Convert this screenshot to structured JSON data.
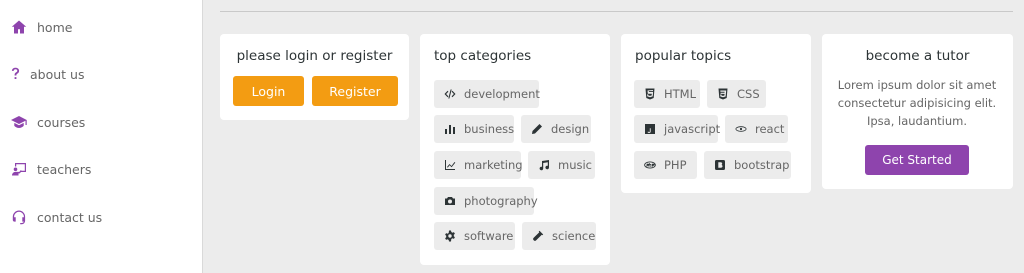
{
  "sidebar": {
    "items": [
      {
        "label": "home",
        "icon": "home-icon"
      },
      {
        "label": "about us",
        "icon": "question-icon"
      },
      {
        "label": "courses",
        "icon": "graduation-cap-icon"
      },
      {
        "label": "teachers",
        "icon": "chalkboard-teacher-icon"
      },
      {
        "label": "contact us",
        "icon": "headset-icon"
      }
    ]
  },
  "login_card": {
    "title": "please login or register",
    "login_label": "Login",
    "register_label": "Register"
  },
  "categories_card": {
    "title": "top categories",
    "tags": [
      {
        "label": "development",
        "icon": "code-icon"
      },
      {
        "label": "business",
        "icon": "bar-chart-icon"
      },
      {
        "label": "design",
        "icon": "pen-icon"
      },
      {
        "label": "marketing",
        "icon": "line-chart-icon"
      },
      {
        "label": "music",
        "icon": "music-icon"
      },
      {
        "label": "photography",
        "icon": "camera-icon"
      },
      {
        "label": "software",
        "icon": "cog-icon"
      },
      {
        "label": "science",
        "icon": "vial-icon"
      }
    ]
  },
  "topics_card": {
    "title": "popular topics",
    "tags": [
      {
        "label": "HTML",
        "icon": "html5-icon"
      },
      {
        "label": "CSS",
        "icon": "css3-icon"
      },
      {
        "label": "javascript",
        "icon": "js-icon"
      },
      {
        "label": "react",
        "icon": "react-icon"
      },
      {
        "label": "PHP",
        "icon": "php-icon"
      },
      {
        "label": "bootstrap",
        "icon": "bootstrap-icon"
      }
    ]
  },
  "tutor_card": {
    "title": "become a tutor",
    "text": "Lorem ipsum dolor sit amet consectetur adipisicing elit. Ipsa, laudantium.",
    "button_label": "Get Started"
  },
  "colors": {
    "accent_purple": "#8e44ad",
    "accent_orange": "#f39c12",
    "background": "#ececec"
  }
}
